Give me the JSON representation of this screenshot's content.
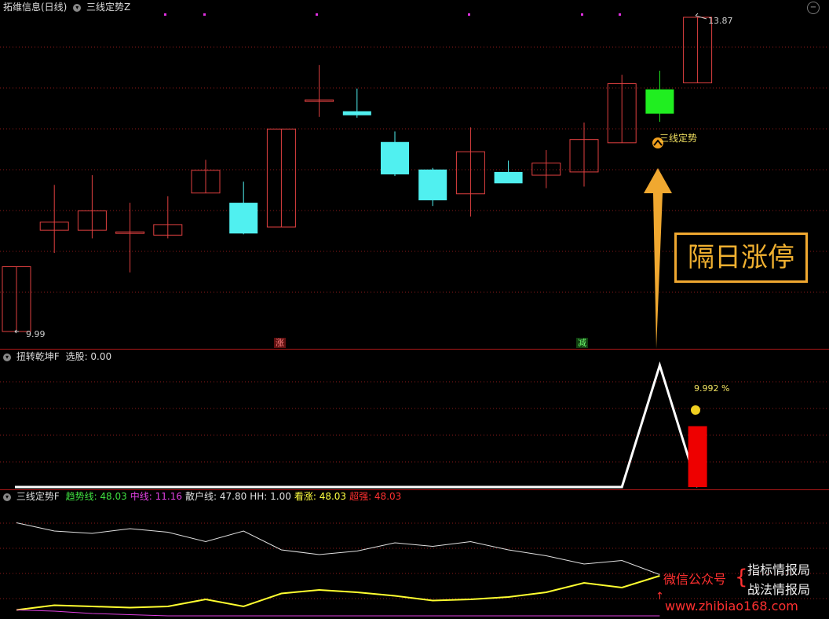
{
  "panel1": {
    "stock": "拓维信息(日线)",
    "indicator": "三线定势Z",
    "price_high_label": "13.87",
    "price_low_label": "9.99",
    "signal_label": "三线定势",
    "badge_up": "涨",
    "badge_down": "减",
    "callout": "隔日涨停"
  },
  "panel2": {
    "title": "扭转乾坤F",
    "xuangu_label": "选股: 0.00",
    "pct_label": "9.992 %"
  },
  "panel3": {
    "title": "三线定势F",
    "legend": [
      {
        "label": "趋势线: 48.03",
        "color": "#40e040"
      },
      {
        "label": "中线: 11.16",
        "color": "#e040e0"
      },
      {
        "label": "散户线: 47.80",
        "color": "#e0e0e0"
      },
      {
        "label": "HH: 1.00",
        "color": "#e0e0e0"
      },
      {
        "label": "看涨: 48.03",
        "color": "#ffff40"
      },
      {
        "label": "超强: 48.03",
        "color": "#ff3030"
      }
    ]
  },
  "watermark": {
    "wechat": "微信公众号",
    "name1": "指标情报局",
    "name2": "战法情报局",
    "url": "www.zhibiao168.com"
  },
  "colors": {
    "up": "#e04040",
    "down": "#50f0f0",
    "limit": "#20ee20",
    "grid": "#8b1a1a",
    "accent": "#f0a830"
  },
  "chart_data": {
    "type": "candlestick",
    "ylim": [
      9.99,
      13.87
    ],
    "candles": [
      {
        "o": 9.99,
        "h": 10.79,
        "l": 9.99,
        "c": 10.79
      },
      {
        "o": 11.24,
        "h": 11.8,
        "l": 10.96,
        "c": 11.34
      },
      {
        "o": 11.24,
        "h": 11.92,
        "l": 11.14,
        "c": 11.48
      },
      {
        "o": 11.22,
        "h": 11.58,
        "l": 10.72,
        "c": 11.22
      },
      {
        "o": 11.18,
        "h": 11.66,
        "l": 11.14,
        "c": 11.31
      },
      {
        "o": 11.7,
        "h": 12.11,
        "l": 11.7,
        "c": 11.98
      },
      {
        "o": 11.58,
        "h": 11.84,
        "l": 11.19,
        "c": 11.2
      },
      {
        "o": 11.28,
        "h": 12.49,
        "l": 11.28,
        "c": 12.49
      },
      {
        "o": 12.85,
        "h": 13.28,
        "l": 12.64,
        "c": 12.85
      },
      {
        "o": 12.71,
        "h": 12.99,
        "l": 12.63,
        "c": 12.66
      },
      {
        "o": 12.33,
        "h": 12.46,
        "l": 11.91,
        "c": 11.93
      },
      {
        "o": 11.99,
        "h": 12.01,
        "l": 11.54,
        "c": 11.61
      },
      {
        "o": 11.69,
        "h": 12.51,
        "l": 11.41,
        "c": 12.21
      },
      {
        "o": 11.96,
        "h": 12.1,
        "l": 11.87,
        "c": 11.82
      },
      {
        "o": 11.92,
        "h": 12.23,
        "l": 11.76,
        "c": 12.07
      },
      {
        "o": 11.96,
        "h": 12.57,
        "l": 11.78,
        "c": 12.36
      },
      {
        "o": 12.32,
        "h": 13.16,
        "l": 12.32,
        "c": 13.05
      },
      {
        "o": 12.68,
        "h": 13.21,
        "l": 12.58,
        "c": 12.98
      },
      {
        "o": 13.06,
        "h": 13.87,
        "l": 13.06,
        "c": 13.87
      }
    ],
    "indicator2": [
      0,
      0,
      0,
      0,
      0,
      0,
      0,
      0,
      0,
      0,
      0,
      0,
      0,
      0,
      0,
      0,
      0,
      100,
      0
    ],
    "bar2_last": 50,
    "sanhu": [
      79,
      72,
      70,
      74,
      71,
      63,
      72,
      56,
      52,
      55,
      62,
      59,
      63,
      56,
      51,
      44,
      47,
      35
    ],
    "kanzhang": [
      5,
      9,
      8,
      7,
      8,
      14,
      8,
      19,
      22,
      20,
      17,
      13,
      14,
      16,
      20,
      28,
      24,
      34
    ],
    "zhongxian": [
      5,
      4,
      2,
      1,
      0,
      0,
      0,
      0,
      0,
      0,
      0,
      0,
      0,
      0,
      0,
      0,
      0,
      0
    ]
  }
}
